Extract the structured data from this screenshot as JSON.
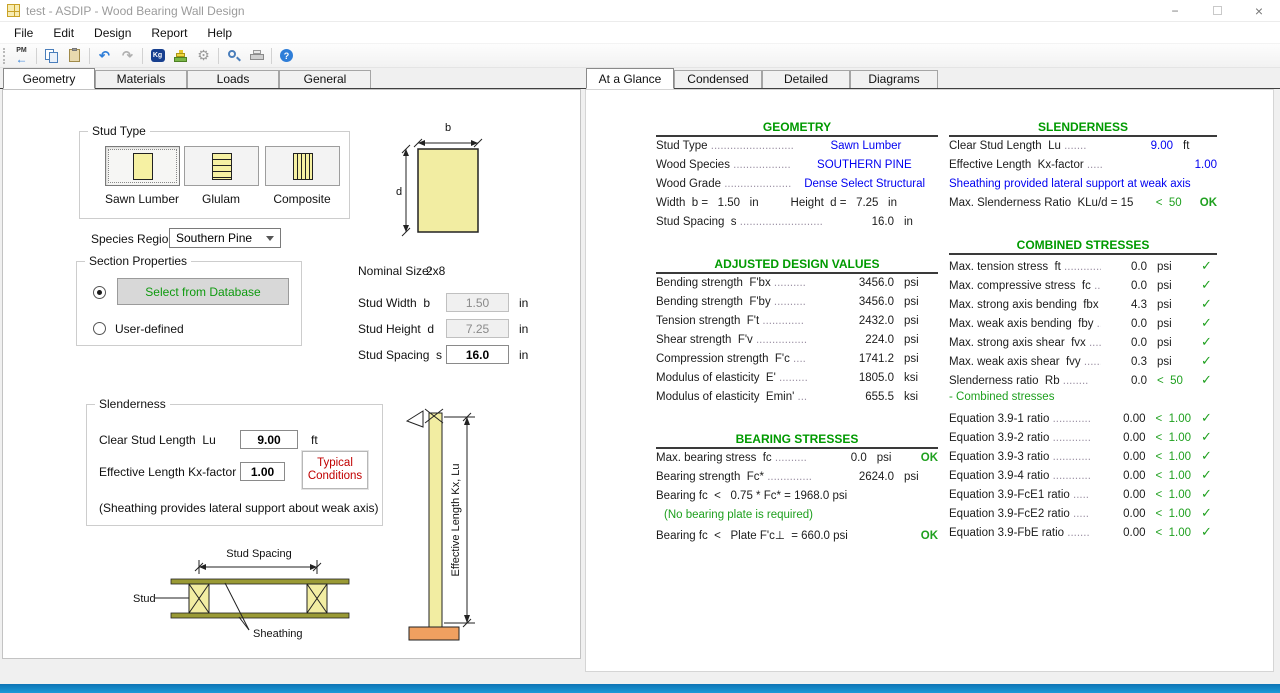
{
  "window": {
    "title": "test - ASDIP - Wood Bearing Wall Design",
    "minimize": "−",
    "close": "×"
  },
  "menu": {
    "items": [
      "File",
      "Edit",
      "Design",
      "Report",
      "Help"
    ]
  },
  "toolbar": {
    "pm_label": "PM",
    "kg_label": "Kg",
    "help_label": "?"
  },
  "left_tabs": {
    "items": [
      {
        "label": "Geometry"
      },
      {
        "label": "Materials"
      },
      {
        "label": "Loads"
      },
      {
        "label": "General"
      }
    ]
  },
  "right_tabs": {
    "items": [
      {
        "label": "At a Glance"
      },
      {
        "label": "Condensed"
      },
      {
        "label": "Detailed"
      },
      {
        "label": "Diagrams"
      }
    ]
  },
  "geometry": {
    "stud_type": {
      "title": "Stud Type",
      "options": [
        {
          "label": "Sawn Lumber"
        },
        {
          "label": "Glulam"
        },
        {
          "label": "Composite"
        }
      ]
    },
    "species_region": {
      "label": "Species Region",
      "value": "Southern Pine"
    },
    "section_properties": {
      "title": "Section Properties",
      "db_button": "Select from Database",
      "user_defined": "User-defined"
    },
    "cross_section": {
      "b": "b",
      "d": "d"
    },
    "size": {
      "nominal_label": "Nominal Size:",
      "nominal_value": "2x8",
      "width": {
        "label": "Stud Width  b",
        "value": "1.50",
        "unit": "in"
      },
      "height": {
        "label": "Stud Height  d",
        "value": "7.25",
        "unit": "in"
      },
      "spacing": {
        "label": "Stud Spacing  s",
        "value": "16.0",
        "unit": "in"
      }
    },
    "slenderness": {
      "title": "Slenderness",
      "clear_length": {
        "label": "Clear Stud Length  Lu",
        "value": "9.00",
        "unit": "ft"
      },
      "kx": {
        "label": "Effective Length Kx-factor",
        "value": "1.00"
      },
      "typical_button": "Typical Conditions",
      "note": "(Sheathing provides lateral support about weak axis)"
    },
    "spacing_diagram": {
      "title": "Stud Spacing",
      "stud": "Stud",
      "sheathing": "Sheathing"
    },
    "column_diagram": {
      "label": "Effective Length Kx, Lu"
    }
  },
  "report": {
    "columns": [
      {
        "sections": [
          {
            "id": "geometry",
            "title": "GEOMETRY",
            "rows": [
              {
                "l": "Stud Type",
                "dots": "..........................",
                "v": "Sawn Lumber",
                "vcenter": true
              },
              {
                "l": "Wood Species",
                "dots": "..................",
                "v": "SOUTHERN PINE",
                "vcenter": true
              },
              {
                "l": "Wood Grade",
                "dots": ".....................",
                "v": "Dense Select Structural",
                "vcenter": true
              },
              {
                "full": "Width  b =   1.50   in          Height  d =   7.25   in"
              },
              {
                "l": "Stud Spacing  s",
                "dots": "..........................",
                "v": "16.0",
                "u": "in"
              }
            ]
          },
          {
            "id": "adjusted",
            "title": "ADJUSTED DESIGN VALUES",
            "rows": [
              {
                "l": "Bending strength  F'bx",
                "dots": "..........",
                "v": "3456.0",
                "u": "psi"
              },
              {
                "l": "Bending strength  F'by",
                "dots": "..........",
                "v": "3456.0",
                "u": "psi"
              },
              {
                "l": "Tension strength  F't",
                "dots": ".............",
                "v": "2432.0",
                "u": "psi"
              },
              {
                "l": "Shear strength  F'v",
                "dots": "................",
                "v": "224.0",
                "u": "psi"
              },
              {
                "l": "Compression strength  F'c",
                "dots": "....",
                "v": "1741.2",
                "u": "psi"
              },
              {
                "l": "Modulus of elasticity  E'",
                "dots": ".........",
                "v": "1805.0",
                "u": "ksi"
              },
              {
                "l": "Modulus of elasticity  Emin'",
                "dots": "...",
                "v": "655.5",
                "u": "ksi"
              }
            ]
          },
          {
            "id": "bearing",
            "title": "BEARING STRESSES",
            "rows": [
              {
                "l": "Max. bearing stress  fc",
                "dots": "..........",
                "v": "0.0",
                "u": "psi",
                "ok": "OK"
              },
              {
                "l": "Bearing strength  Fc*",
                "dots": "..............",
                "v": "2624.0",
                "u": "psi"
              },
              {
                "full": "Bearing fc  <   0.75 * Fc* = 1968.0 psi"
              },
              {
                "full": "(No bearing plate is required)",
                "cls": "green",
                "indent": true
              },
              {
                "l": "Bearing fc  <   Plate F'c⊥  = 660.0 psi",
                "ok": "OK"
              }
            ]
          }
        ]
      },
      {
        "sections": [
          {
            "id": "slenderness",
            "title": "SLENDERNESS",
            "rows": [
              {
                "l": "Clear Stud Length  Lu",
                "dots": ".......",
                "v": "9.00",
                "vcls": "blue",
                "u": "ft"
              },
              {
                "l": "Effective Length  Kx-factor",
                "dots": ".....",
                "v": "1.00",
                "vcls": "blue"
              },
              {
                "full": "Sheathing provided lateral support at weak axis",
                "cls": "blue"
              },
              {
                "l": "Max. Slenderness Ratio  KLu/d = 15",
                "x": "<  50",
                "ok": "OK"
              }
            ]
          },
          {
            "id": "combined",
            "title": "COMBINED STRESSES",
            "rows": [
              {
                "l": "Max. tension stress  ft",
                "dots": "...............",
                "v": "0.0",
                "u": "psi",
                "chk": true
              },
              {
                "l": "Max. compressive stress  fc",
                "dots": "....",
                "v": "0.0",
                "u": "psi",
                "chk": true
              },
              {
                "l": "Max. strong axis bending  fbx",
                "dots": "..",
                "v": "4.3",
                "u": "psi",
                "chk": true
              },
              {
                "l": "Max. weak axis bending  fby",
                "dots": "....",
                "v": "0.0",
                "u": "psi",
                "chk": true
              },
              {
                "l": "Max. strong axis shear  fvx",
                "dots": "......",
                "v": "0.0",
                "u": "psi",
                "chk": true
              },
              {
                "l": "Max. weak axis shear  fvy",
                "dots": "........",
                "v": "0.3",
                "u": "psi",
                "chk": true
              },
              {
                "l": "Slenderness ratio  Rb",
                "dots": "........",
                "v": "0.0",
                "x": "<  50",
                "chk": true
              },
              {
                "full": "- Combined stresses",
                "cls": "green"
              },
              {
                "l": "Equation 3.9-1 ratio",
                "dots": "............",
                "v": "0.00",
                "x": "<  1.00",
                "chk": true
              },
              {
                "l": "Equation 3.9-2 ratio",
                "dots": "............",
                "v": "0.00",
                "x": "<  1.00",
                "chk": true
              },
              {
                "l": "Equation 3.9-3 ratio",
                "dots": "............",
                "v": "0.00",
                "x": "<  1.00",
                "chk": true
              },
              {
                "l": "Equation 3.9-4 ratio",
                "dots": "............",
                "v": "0.00",
                "x": "<  1.00",
                "chk": true
              },
              {
                "l": "Equation 3.9-FcE1 ratio",
                "dots": ".....",
                "v": "0.00",
                "x": "<  1.00",
                "chk": true
              },
              {
                "l": "Equation 3.9-FcE2 ratio",
                "dots": ".....",
                "v": "0.00",
                "x": "<  1.00",
                "chk": true
              },
              {
                "l": "Equation 3.9-FbE ratio",
                "dots": ".......",
                "v": "0.00",
                "x": "<  1.00",
                "chk": true
              }
            ]
          }
        ]
      }
    ]
  },
  "colors": {
    "header_green": "#009a00",
    "value_blue": "#0000f0",
    "ok_green": "#1fa01f",
    "button_red": "#c00000",
    "stud_yellow": "#f6f1a3",
    "base_orange": "#f0a060"
  }
}
